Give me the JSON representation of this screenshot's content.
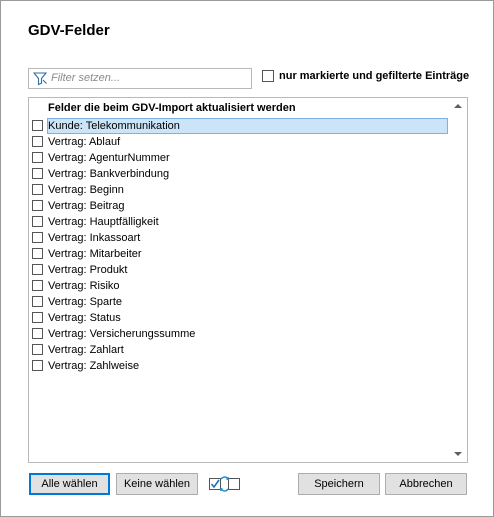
{
  "dialog": {
    "title": "GDV-Felder"
  },
  "filter": {
    "placeholder": "Filter setzen...",
    "value": ""
  },
  "only_marked": {
    "label": "nur markierte und gefilterte Einträge",
    "checked": false
  },
  "list": {
    "header": "Felder die beim GDV-Import aktualisiert werden",
    "items": [
      {
        "label": "Kunde: Telekommunikation",
        "checked": false,
        "selected": true
      },
      {
        "label": "Vertrag: Ablauf",
        "checked": false
      },
      {
        "label": "Vertrag: AgenturNummer",
        "checked": false
      },
      {
        "label": "Vertrag: Bankverbindung",
        "checked": false
      },
      {
        "label": "Vertrag: Beginn",
        "checked": false
      },
      {
        "label": "Vertrag: Beitrag",
        "checked": false
      },
      {
        "label": "Vertrag: Hauptfälligkeit",
        "checked": false
      },
      {
        "label": "Vertrag: Inkassoart",
        "checked": false
      },
      {
        "label": "Vertrag: Mitarbeiter",
        "checked": false
      },
      {
        "label": "Vertrag: Produkt",
        "checked": false
      },
      {
        "label": "Vertrag: Risiko",
        "checked": false
      },
      {
        "label": "Vertrag: Sparte",
        "checked": false
      },
      {
        "label": "Vertrag: Status",
        "checked": false
      },
      {
        "label": "Vertrag: Versicherungssumme",
        "checked": false
      },
      {
        "label": "Vertrag: Zahlart",
        "checked": false
      },
      {
        "label": "Vertrag: Zahlweise",
        "checked": false
      }
    ]
  },
  "buttons": {
    "select_all": "Alle wählen",
    "select_none": "Keine wählen",
    "invert_icon": "toggle-selection-icon",
    "save": "Speichern",
    "cancel": "Abbrechen"
  },
  "colors": {
    "selection": "#cce4f7",
    "selection_border": "#7fb1e0",
    "primary_border": "#0078d7",
    "accent_icon": "#1f8fd6"
  }
}
